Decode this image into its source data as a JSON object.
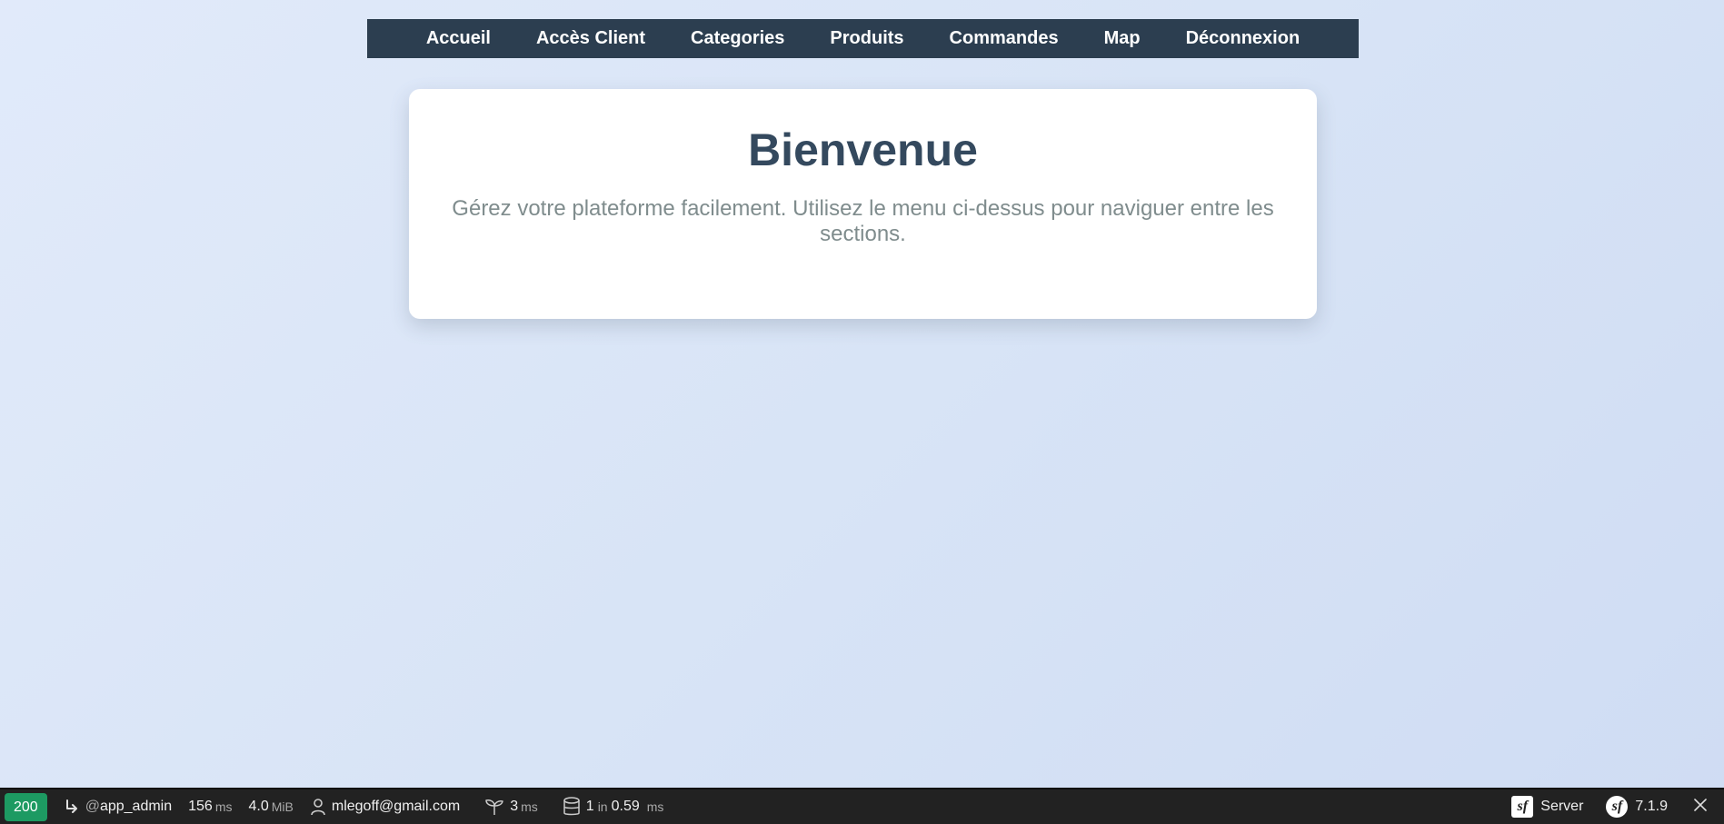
{
  "nav": {
    "items": [
      {
        "label": "Accueil"
      },
      {
        "label": "Accès Client"
      },
      {
        "label": "Categories"
      },
      {
        "label": "Produits"
      },
      {
        "label": "Commandes"
      },
      {
        "label": "Map"
      },
      {
        "label": "Déconnexion"
      }
    ]
  },
  "welcome": {
    "title": "Bienvenue",
    "text": "Gérez votre plateforme facilement. Utilisez le menu ci-dessus pour naviguer entre les sections."
  },
  "debug_toolbar": {
    "status_code": "200",
    "route_prefix": "@",
    "route": "app_admin",
    "time_value": "156",
    "time_unit": "ms",
    "memory_value": "4.0",
    "memory_unit": "MiB",
    "user": "mlegoff@gmail.com",
    "init_value": "3",
    "init_unit": "ms",
    "db_queries": "1",
    "db_in": "in",
    "db_time": "0.59",
    "db_unit": "ms",
    "server_label": "Server",
    "version": "7.1.9",
    "icons": [
      "route-arrow-icon",
      "user-icon",
      "sprout-icon",
      "database-icon",
      "symfony-icon",
      "close-icon"
    ],
    "colors": {
      "status_ok": "#1d9a62",
      "background": "#222222"
    }
  }
}
